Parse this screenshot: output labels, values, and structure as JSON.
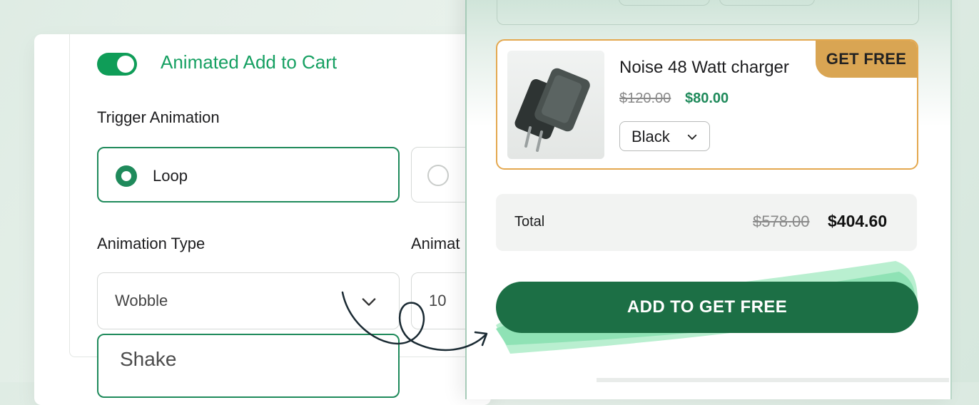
{
  "settings": {
    "toggle_label": "Animated Add to Cart",
    "trigger_label": "Trigger Animation",
    "trigger_options": [
      {
        "label": "Loop",
        "selected": true
      },
      {
        "label": "",
        "selected": false
      }
    ],
    "animation_type_label": "Animation Type",
    "animation_type_value": "Wobble",
    "second_field_label": "Animat",
    "second_field_value": "10",
    "dropdown_option": "Shake"
  },
  "cart": {
    "product": {
      "badge": "GET FREE",
      "name": "Noise 48 Watt charger",
      "price_old": "$120.00",
      "price_new": "$80.00",
      "variant": "Black"
    },
    "total": {
      "label": "Total",
      "old": "$578.00",
      "new": "$404.60"
    },
    "cta_label": "ADD TO GET FREE"
  },
  "colors": {
    "accent_green": "#1f8a5b",
    "toggle_green": "#0f9d58",
    "button_green": "#1c6f45",
    "badge_gold": "#d9a553",
    "card_border_orange": "#e4a84f"
  }
}
